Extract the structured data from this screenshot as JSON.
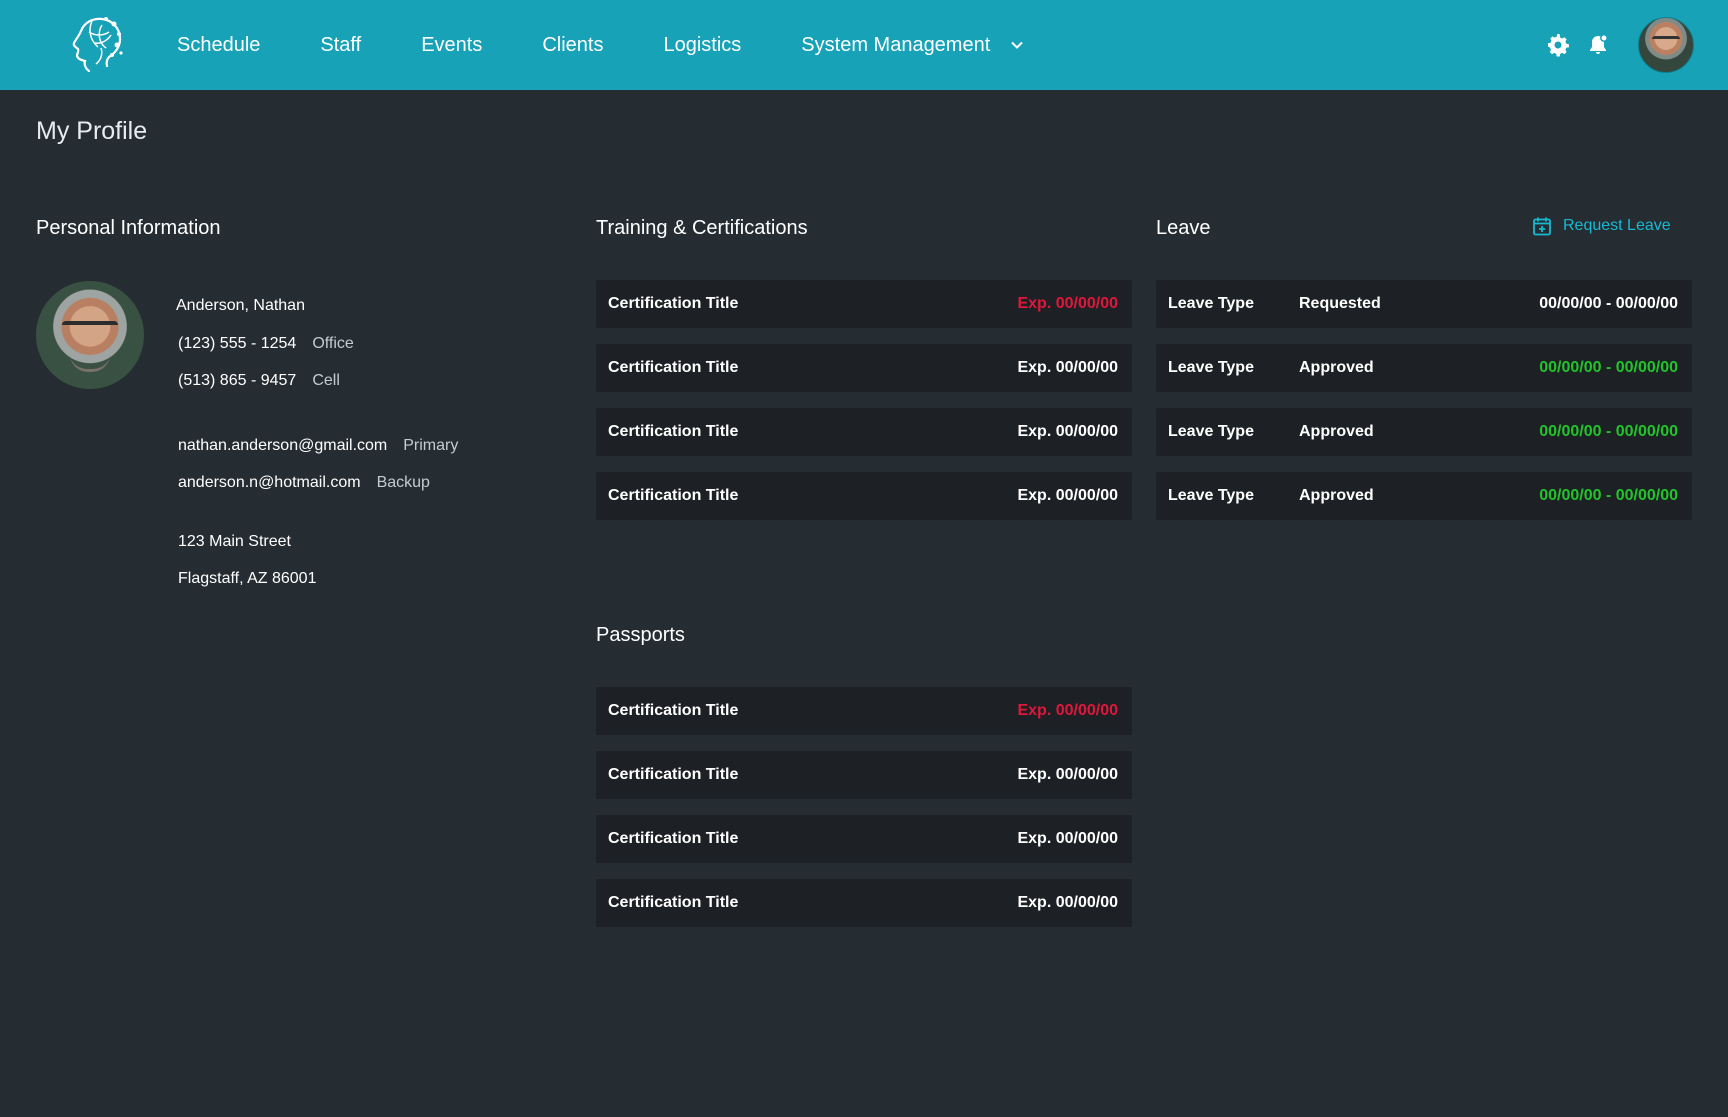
{
  "colors": {
    "topbar": "#17a2b8",
    "background": "#262d32",
    "card": "#1d2024",
    "expired": "#e0173a",
    "approved": "#22c32b",
    "link": "#16b9d1"
  },
  "nav": {
    "logo_icon": "ai-head-logo-icon",
    "items": [
      "Schedule",
      "Staff",
      "Events",
      "Clients",
      "Logistics"
    ],
    "system_management": "System Management"
  },
  "page": {
    "title": "My Profile"
  },
  "personal": {
    "title": "Personal Information",
    "name": "Anderson,  Nathan",
    "phones": [
      {
        "number": "(123) 555 - 1254",
        "label": "Office"
      },
      {
        "number": "(513) 865 - 9457",
        "label": "Cell"
      }
    ],
    "emails": [
      {
        "address": "nathan.anderson@gmail.com",
        "label": "Primary"
      },
      {
        "address": "anderson.n@hotmail.com",
        "label": "Backup"
      }
    ],
    "address": [
      "123 Main Street",
      "Flagstaff, AZ 86001"
    ]
  },
  "training": {
    "title": "Training & Certifications",
    "items": [
      {
        "title": "Certification Title",
        "expiry": "Exp. 00/00/00",
        "expired": true
      },
      {
        "title": "Certification Title",
        "expiry": "Exp. 00/00/00",
        "expired": false
      },
      {
        "title": "Certification Title",
        "expiry": "Exp. 00/00/00",
        "expired": false
      },
      {
        "title": "Certification Title",
        "expiry": "Exp. 00/00/00",
        "expired": false
      }
    ]
  },
  "leave": {
    "title": "Leave",
    "request_label": "Request Leave",
    "items": [
      {
        "type": "Leave Type",
        "status": "Requested",
        "dates": "00/00/00 - 00/00/00"
      },
      {
        "type": "Leave Type",
        "status": "Approved",
        "dates": "00/00/00 - 00/00/00"
      },
      {
        "type": "Leave Type",
        "status": "Approved",
        "dates": "00/00/00 - 00/00/00"
      },
      {
        "type": "Leave Type",
        "status": "Approved",
        "dates": "00/00/00 - 00/00/00"
      }
    ]
  },
  "passports": {
    "title": "Passports",
    "items": [
      {
        "title": "Certification Title",
        "expiry": "Exp. 00/00/00",
        "expired": true
      },
      {
        "title": "Certification Title",
        "expiry": "Exp. 00/00/00",
        "expired": false
      },
      {
        "title": "Certification Title",
        "expiry": "Exp. 00/00/00",
        "expired": false
      },
      {
        "title": "Certification Title",
        "expiry": "Exp. 00/00/00",
        "expired": false
      }
    ]
  }
}
